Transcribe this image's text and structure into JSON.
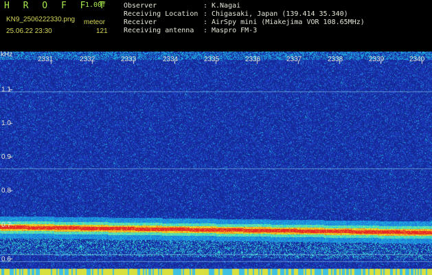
{
  "header": {
    "title": "H R O F F T",
    "version": "1.00f",
    "filename": "KN9_2506222330.png",
    "kind": "meteor",
    "datetime": "25.06.22 23:30",
    "count": "121"
  },
  "info": [
    {
      "label": "Observer",
      "value": "K.Nagai"
    },
    {
      "label": "Receiving Location",
      "value": "Chigasaki, Japan (139.414 35.340)"
    },
    {
      "label": "Receiver",
      "value": "AirSpy mini (Miakejima VOR 108.65MHz)"
    },
    {
      "label": "Receiving antenna",
      "value": "Maspro FM-3"
    }
  ],
  "info_separator": ":",
  "spectrogram": {
    "y_unit": "kHz",
    "y_ticks": [
      "1.1",
      "1.0",
      "0.9",
      "0.8",
      "0.7",
      "0.6"
    ],
    "x_ticks": [
      "2331",
      "2332",
      "2333",
      "2334",
      "2335",
      "2336",
      "2337",
      "2338",
      "2339",
      "2340"
    ],
    "colors": {
      "background": "#1a35b8",
      "noise": "#1e9ad8",
      "signal": "#e83030",
      "halo": "#f0d820",
      "bottom_bar": "#d8e040"
    }
  }
}
